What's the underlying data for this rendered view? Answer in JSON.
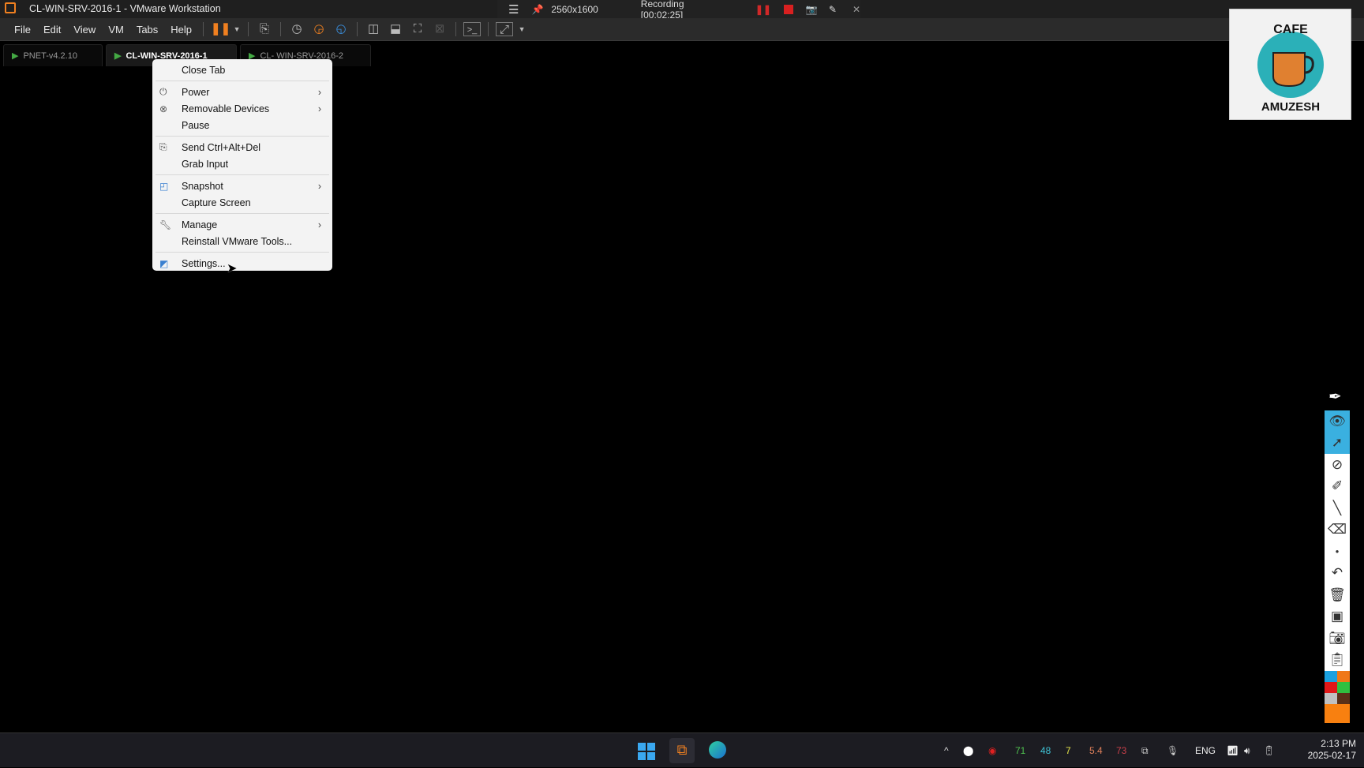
{
  "window": {
    "title": "CL-WIN-SRV-2016-1 - VMware Workstation"
  },
  "menubar": [
    "File",
    "Edit",
    "View",
    "VM",
    "Tabs",
    "Help"
  ],
  "tabs": [
    {
      "label": "PNET-v4.2.10"
    },
    {
      "label": "CL-WIN-SRV-2016-1"
    },
    {
      "label": "CL- WIN-SRV-2016-2"
    }
  ],
  "recorder": {
    "resolution": "2560x1600",
    "status": "Recording [00:02:25]"
  },
  "context_menu": [
    {
      "label": "Close Tab"
    },
    {
      "label": "Power",
      "icon": "power-icon",
      "submenu": true
    },
    {
      "label": "Removable Devices",
      "icon": "removable-devices-icon",
      "submenu": true
    },
    {
      "label": "Pause"
    },
    {
      "label": "Send Ctrl+Alt+Del",
      "icon": "keyboard-icon"
    },
    {
      "label": "Grab Input"
    },
    {
      "label": "Snapshot",
      "icon": "snapshot-icon",
      "submenu": true
    },
    {
      "label": "Capture Screen"
    },
    {
      "label": "Manage",
      "icon": "wrench-icon",
      "submenu": true
    },
    {
      "label": "Reinstall VMware Tools..."
    },
    {
      "label": "Settings...",
      "icon": "settings-icon"
    }
  ],
  "logo": {
    "text": "CAFE AMUZESH"
  },
  "tray": {
    "stats": [
      {
        "v": "71",
        "c": "#4fc04f"
      },
      {
        "v": "48",
        "c": "#3fc3d6"
      },
      {
        "v": "7",
        "c": "#e6e64a"
      },
      {
        "v": "5.4",
        "c": "#e0805a"
      },
      {
        "v": "73",
        "c": "#c8404a"
      }
    ],
    "lang": "ENG",
    "time": "2:13 PM",
    "date": "2025-02-17"
  },
  "colors": {
    "accent_orange": "#f08020",
    "palette": [
      "#1aa0e0",
      "#f07818",
      "#e01818",
      "#30c040",
      "#c0c0c0",
      "#5a3018",
      "#f88010"
    ]
  }
}
